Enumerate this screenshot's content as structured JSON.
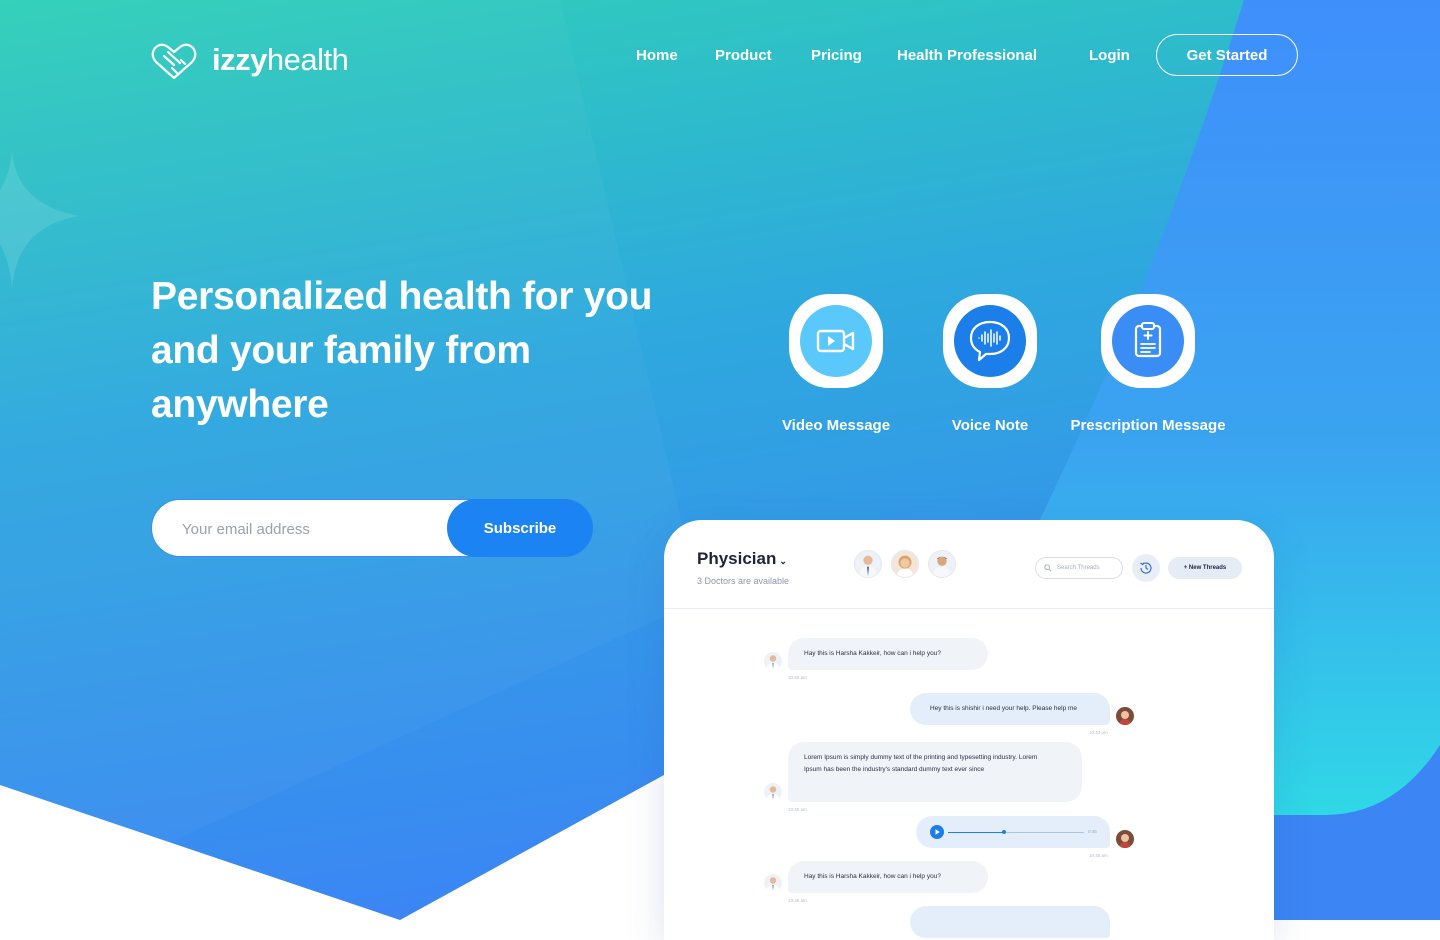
{
  "brand": {
    "name_bold": "izzy",
    "name_light": "health"
  },
  "nav": {
    "items": [
      "Home",
      "Product",
      "Pricing",
      "Health Professional"
    ],
    "login": "Login",
    "cta": "Get Started"
  },
  "hero": {
    "title": "Personalized health for you and your family from anywhere",
    "email_placeholder": "Your email address",
    "subscribe": "Subscribe"
  },
  "features": [
    {
      "label": "Video Message",
      "icon": "video-camera-icon"
    },
    {
      "label": "Voice Note",
      "icon": "voice-bubble-icon"
    },
    {
      "label": "Prescription Message",
      "icon": "clipboard-icon"
    }
  ],
  "chat": {
    "title": "Physician",
    "subtitle": "3 Doctors are available",
    "search_placeholder": "Search Threads",
    "new_threads": "+ New Threads",
    "messages": [
      {
        "dir": "in",
        "text": "Hay this is Harsha Kakkeir, how can i help you?",
        "time": "10:45 am"
      },
      {
        "dir": "out",
        "text": "Hey this is shishir i need your help. Please help me",
        "time": "10:43 pm"
      },
      {
        "dir": "in",
        "text": "Lorem Ipsum is simply dummy text of the printing and typesetting industry. Lorem Ipsum has been the industry's standard dummy text ever since",
        "time": "10:45 am"
      },
      {
        "dir": "out",
        "type": "audio",
        "duration": "0:45",
        "time": "10:45 am"
      },
      {
        "dir": "in",
        "text": "Hay this is Harsha Kakkeir, how can i help you?",
        "time": "10:45 am"
      }
    ]
  },
  "colors": {
    "teal": "#2fcfb9",
    "blue": "#3a8cf4",
    "accent": "#1c84f2",
    "cyan": "#33d6e3"
  }
}
